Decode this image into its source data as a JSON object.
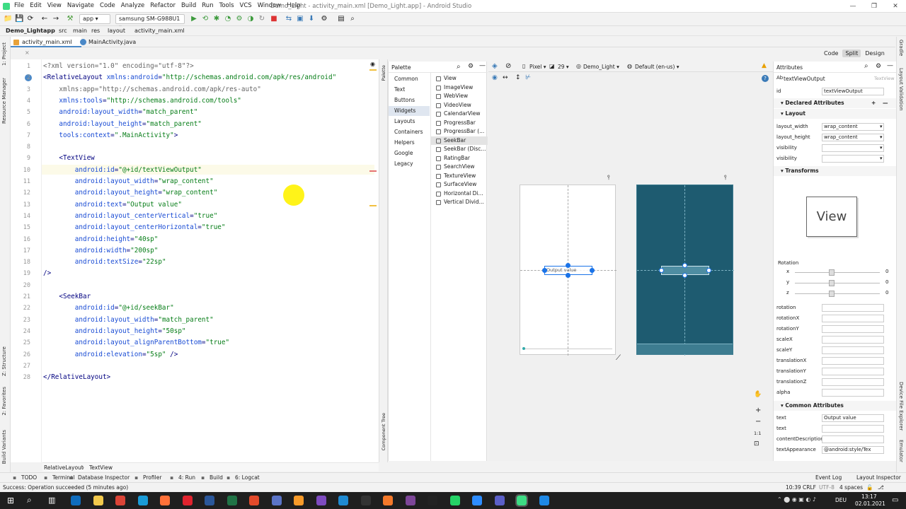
{
  "window": {
    "title": "Demo_Light - activity_main.xml [Demo_Light.app] - Android Studio",
    "menus": [
      "File",
      "Edit",
      "View",
      "Navigate",
      "Code",
      "Analyze",
      "Refactor",
      "Build",
      "Run",
      "Tools",
      "VCS",
      "Window",
      "Help"
    ]
  },
  "toolbar": {
    "module": "app",
    "device": "samsung SM-G988U1"
  },
  "breadcrumbs": [
    "Demo_Light",
    "app",
    "src",
    "main",
    "res",
    "layout",
    "activity_main.xml"
  ],
  "tabs": [
    {
      "label": "activity_main.xml",
      "active": true
    },
    {
      "label": "MainActivity.java",
      "active": false
    }
  ],
  "left_strip": [
    "1: Project",
    "Resource Manager",
    "Z: Structure",
    "2: Favorites",
    "Build Variants"
  ],
  "right_strip": [
    "Gradle",
    "Layout Validation",
    "Device File Explorer",
    "Emulator"
  ],
  "editor": {
    "lines": [
      {
        "n": "1",
        "segs": [
          [
            "p",
            "<?xml version=\"1.0\" encoding=\"utf-8\"?>"
          ]
        ]
      },
      {
        "n": "2",
        "segs": [
          [
            "t",
            "<RelativeLayout "
          ],
          [
            "a",
            "xmlns:android"
          ],
          [
            "t",
            "="
          ],
          [
            "v",
            "\"http://schemas.android.com/apk/res/android\""
          ]
        ]
      },
      {
        "n": "3",
        "segs": [
          [
            "p",
            "    xmlns:app=\"http://schemas.android.com/apk/res-auto\""
          ]
        ]
      },
      {
        "n": "4",
        "segs": [
          [
            "a",
            "    xmlns:tools"
          ],
          [
            "t",
            "="
          ],
          [
            "v",
            "\"http://schemas.android.com/tools\""
          ]
        ]
      },
      {
        "n": "5",
        "segs": [
          [
            "a",
            "    android:layout_width"
          ],
          [
            "t",
            "="
          ],
          [
            "v",
            "\"match_parent\""
          ]
        ]
      },
      {
        "n": "6",
        "segs": [
          [
            "a",
            "    android:layout_height"
          ],
          [
            "t",
            "="
          ],
          [
            "v",
            "\"match_parent\""
          ]
        ]
      },
      {
        "n": "7",
        "segs": [
          [
            "a",
            "    tools:context"
          ],
          [
            "t",
            "="
          ],
          [
            "v",
            "\".MainActivity\""
          ],
          [
            "t",
            ">"
          ]
        ]
      },
      {
        "n": "8",
        "segs": [
          [
            "t",
            ""
          ]
        ]
      },
      {
        "n": "9",
        "segs": [
          [
            "t",
            "    <TextView"
          ]
        ]
      },
      {
        "n": "10",
        "segs": [
          [
            "a",
            "        android:id"
          ],
          [
            "t",
            "="
          ],
          [
            "v",
            "\"@+id/textViewOutput\""
          ]
        ]
      },
      {
        "n": "11",
        "segs": [
          [
            "a",
            "        android:layout_width"
          ],
          [
            "t",
            "="
          ],
          [
            "v",
            "\"wrap_content\""
          ]
        ]
      },
      {
        "n": "12",
        "segs": [
          [
            "a",
            "        android:layout_height"
          ],
          [
            "t",
            "="
          ],
          [
            "v",
            "\"wrap_content\""
          ]
        ]
      },
      {
        "n": "13",
        "segs": [
          [
            "a",
            "        android:text"
          ],
          [
            "t",
            "="
          ],
          [
            "v",
            "\"Output value\""
          ]
        ]
      },
      {
        "n": "14",
        "segs": [
          [
            "a",
            "        android:layout_centerVertical"
          ],
          [
            "t",
            "="
          ],
          [
            "v",
            "\"true\""
          ]
        ]
      },
      {
        "n": "15",
        "segs": [
          [
            "a",
            "        android:layout_centerHorizontal"
          ],
          [
            "t",
            "="
          ],
          [
            "v",
            "\"true\""
          ]
        ]
      },
      {
        "n": "16",
        "segs": [
          [
            "a",
            "        android:height"
          ],
          [
            "t",
            "="
          ],
          [
            "v",
            "\"40sp\""
          ]
        ]
      },
      {
        "n": "17",
        "segs": [
          [
            "a",
            "        android:width"
          ],
          [
            "t",
            "="
          ],
          [
            "v",
            "\"200sp\""
          ]
        ]
      },
      {
        "n": "18",
        "segs": [
          [
            "a",
            "        android:textSize"
          ],
          [
            "t",
            "="
          ],
          [
            "v",
            "\"22sp\""
          ]
        ]
      },
      {
        "n": "19",
        "segs": [
          [
            "t",
            "/>"
          ]
        ]
      },
      {
        "n": "20",
        "segs": [
          [
            "t",
            ""
          ]
        ]
      },
      {
        "n": "21",
        "segs": [
          [
            "t",
            "    <SeekBar"
          ]
        ]
      },
      {
        "n": "22",
        "segs": [
          [
            "a",
            "        android:id"
          ],
          [
            "t",
            "="
          ],
          [
            "v",
            "\"@+id/seekBar\""
          ]
        ]
      },
      {
        "n": "23",
        "segs": [
          [
            "a",
            "        android:layout_width"
          ],
          [
            "t",
            "="
          ],
          [
            "v",
            "\"match_parent\""
          ]
        ]
      },
      {
        "n": "24",
        "segs": [
          [
            "a",
            "        android:layout_height"
          ],
          [
            "t",
            "="
          ],
          [
            "v",
            "\"50sp\""
          ]
        ]
      },
      {
        "n": "25",
        "segs": [
          [
            "a",
            "        android:layout_alignParentBottom"
          ],
          [
            "t",
            "="
          ],
          [
            "v",
            "\"true\""
          ]
        ]
      },
      {
        "n": "26",
        "segs": [
          [
            "a",
            "        android:elevation"
          ],
          [
            "t",
            "="
          ],
          [
            "v",
            "\"5sp\""
          ],
          [
            "t",
            " />"
          ]
        ]
      },
      {
        "n": "27",
        "segs": [
          [
            "t",
            ""
          ]
        ]
      },
      {
        "n": "28",
        "segs": [
          [
            "t",
            "</RelativeLayout>"
          ]
        ]
      }
    ]
  },
  "editor_modes": [
    "Code",
    "Split",
    "Design"
  ],
  "palette": {
    "title": "Palette",
    "categories": [
      "Common",
      "Text",
      "Buttons",
      "Widgets",
      "Layouts",
      "Containers",
      "Helpers",
      "Google",
      "Legacy"
    ],
    "selected_category": "Widgets",
    "widgets": [
      "View",
      "ImageView",
      "WebView",
      "VideoView",
      "CalendarView",
      "ProgressBar",
      "ProgressBar (...",
      "SeekBar",
      "SeekBar (Disc...",
      "RatingBar",
      "SearchView",
      "TextureView",
      "SurfaceView",
      "Horizontal Di...",
      "Vertical Divid..."
    ],
    "selected_widget": "SeekBar",
    "side_labels": [
      "Palette",
      "Component Tree"
    ]
  },
  "design_toolbar": {
    "device": "Pixel",
    "api": "29",
    "theme": "Demo_Light",
    "locale": "Default (en-us)"
  },
  "preview": {
    "text": "Output value"
  },
  "zoom_labels": [
    "1:1"
  ],
  "attributes": {
    "title": "Attributes",
    "component": "textViewOutput",
    "component_type": "TextView",
    "id": "textViewOutput",
    "sections": {
      "declared": "Declared Attributes",
      "layout": "Layout",
      "transforms": "Transforms",
      "common": "Common Attributes"
    },
    "layout": [
      {
        "name": "layout_width",
        "value": "wrap_content"
      },
      {
        "name": "layout_height",
        "value": "wrap_content"
      },
      {
        "name": "visibility",
        "value": ""
      },
      {
        "name": "visibility",
        "value": ""
      }
    ],
    "view_box_label": "View",
    "rotation_label": "Rotation",
    "rotation_axes": [
      {
        "axis": "x",
        "value": "0"
      },
      {
        "axis": "y",
        "value": "0"
      },
      {
        "axis": "z",
        "value": "0"
      }
    ],
    "transforms": [
      "rotation",
      "rotationX",
      "rotationY",
      "scaleX",
      "scaleY",
      "translationX",
      "translationY",
      "translationZ",
      "alpha"
    ],
    "common": [
      {
        "name": "text",
        "value": "Output value"
      },
      {
        "name": "text",
        "value": ""
      },
      {
        "name": "contentDescription",
        "value": ""
      },
      {
        "name": "textAppearance",
        "value": "@android:style/Tex"
      }
    ]
  },
  "structure": [
    "RelativeLayout",
    "TextView"
  ],
  "bottom_tools": [
    "TODO",
    "Terminal",
    "Database Inspector",
    "Profiler",
    "4: Run",
    "Build",
    "6: Logcat"
  ],
  "bottom_right": [
    "Event Log",
    "Layout Inspector"
  ],
  "status": {
    "message": "Success: Operation succeeded (5 minutes ago)",
    "position": "10:39",
    "line_sep": "CRLF",
    "encoding": "UTF-8",
    "indent": "4 spaces"
  },
  "taskbar": {
    "lang": "DEU",
    "time": "13:17",
    "date": "02.01.2021"
  },
  "colors": {
    "accent": "#4a88c7",
    "dark_preview": "#1e5b70",
    "selection": "#1a73e8"
  }
}
